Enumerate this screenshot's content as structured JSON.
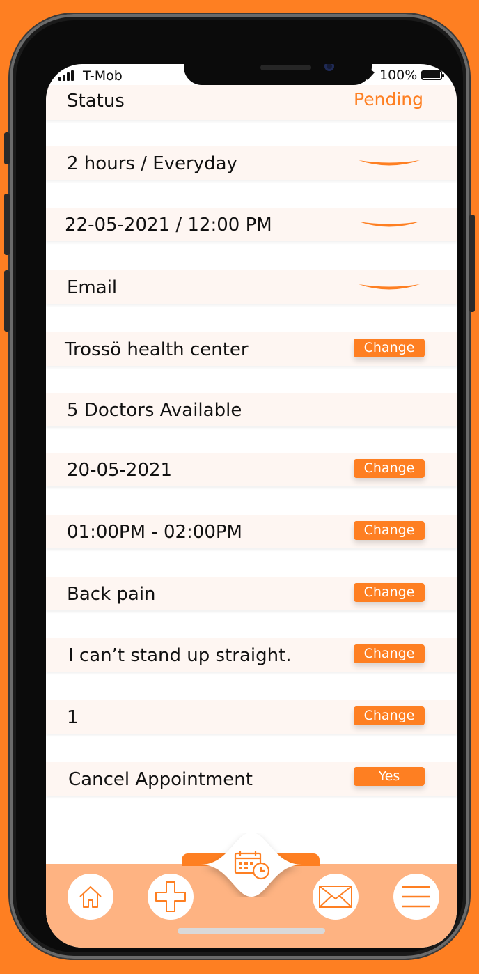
{
  "status_bar": {
    "carrier": "T-Mob",
    "battery": "100%"
  },
  "status_row": {
    "label": "Status",
    "value": "Pending"
  },
  "rows": [
    {
      "text": "2 hours / Everyday",
      "control": "dropdown"
    },
    {
      "text": "22-05-2021 / 12:00 PM",
      "control": "dropdown"
    },
    {
      "text": "Email",
      "control": "dropdown"
    },
    {
      "text": "Trossö health center",
      "control": "button",
      "button_label": "Change"
    },
    {
      "text": "5 Doctors Available",
      "control": "none"
    },
    {
      "text": "20-05-2021",
      "control": "button",
      "button_label": "Change"
    },
    {
      "text": "01:00PM - 02:00PM",
      "control": "button",
      "button_label": "Change"
    },
    {
      "text": "Back pain",
      "control": "button",
      "button_label": "Change"
    },
    {
      "text": "I can’t stand up straight.",
      "control": "button",
      "button_label": "Change"
    },
    {
      "text": "1",
      "control": "button",
      "button_label": "Change"
    },
    {
      "text": "Cancel Appointment",
      "control": "button",
      "button_label": "Yes"
    }
  ],
  "nav": {
    "items": [
      {
        "icon": "home-icon"
      },
      {
        "icon": "plus-icon"
      },
      {
        "icon": "calendar-clock-icon",
        "active": true
      },
      {
        "icon": "mail-icon"
      },
      {
        "icon": "menu-icon"
      }
    ]
  },
  "colors": {
    "accent": "#FE7F22",
    "row_background": "#FEF6F2",
    "tab_bar": "#FEB382",
    "background": "#FE7F22"
  }
}
